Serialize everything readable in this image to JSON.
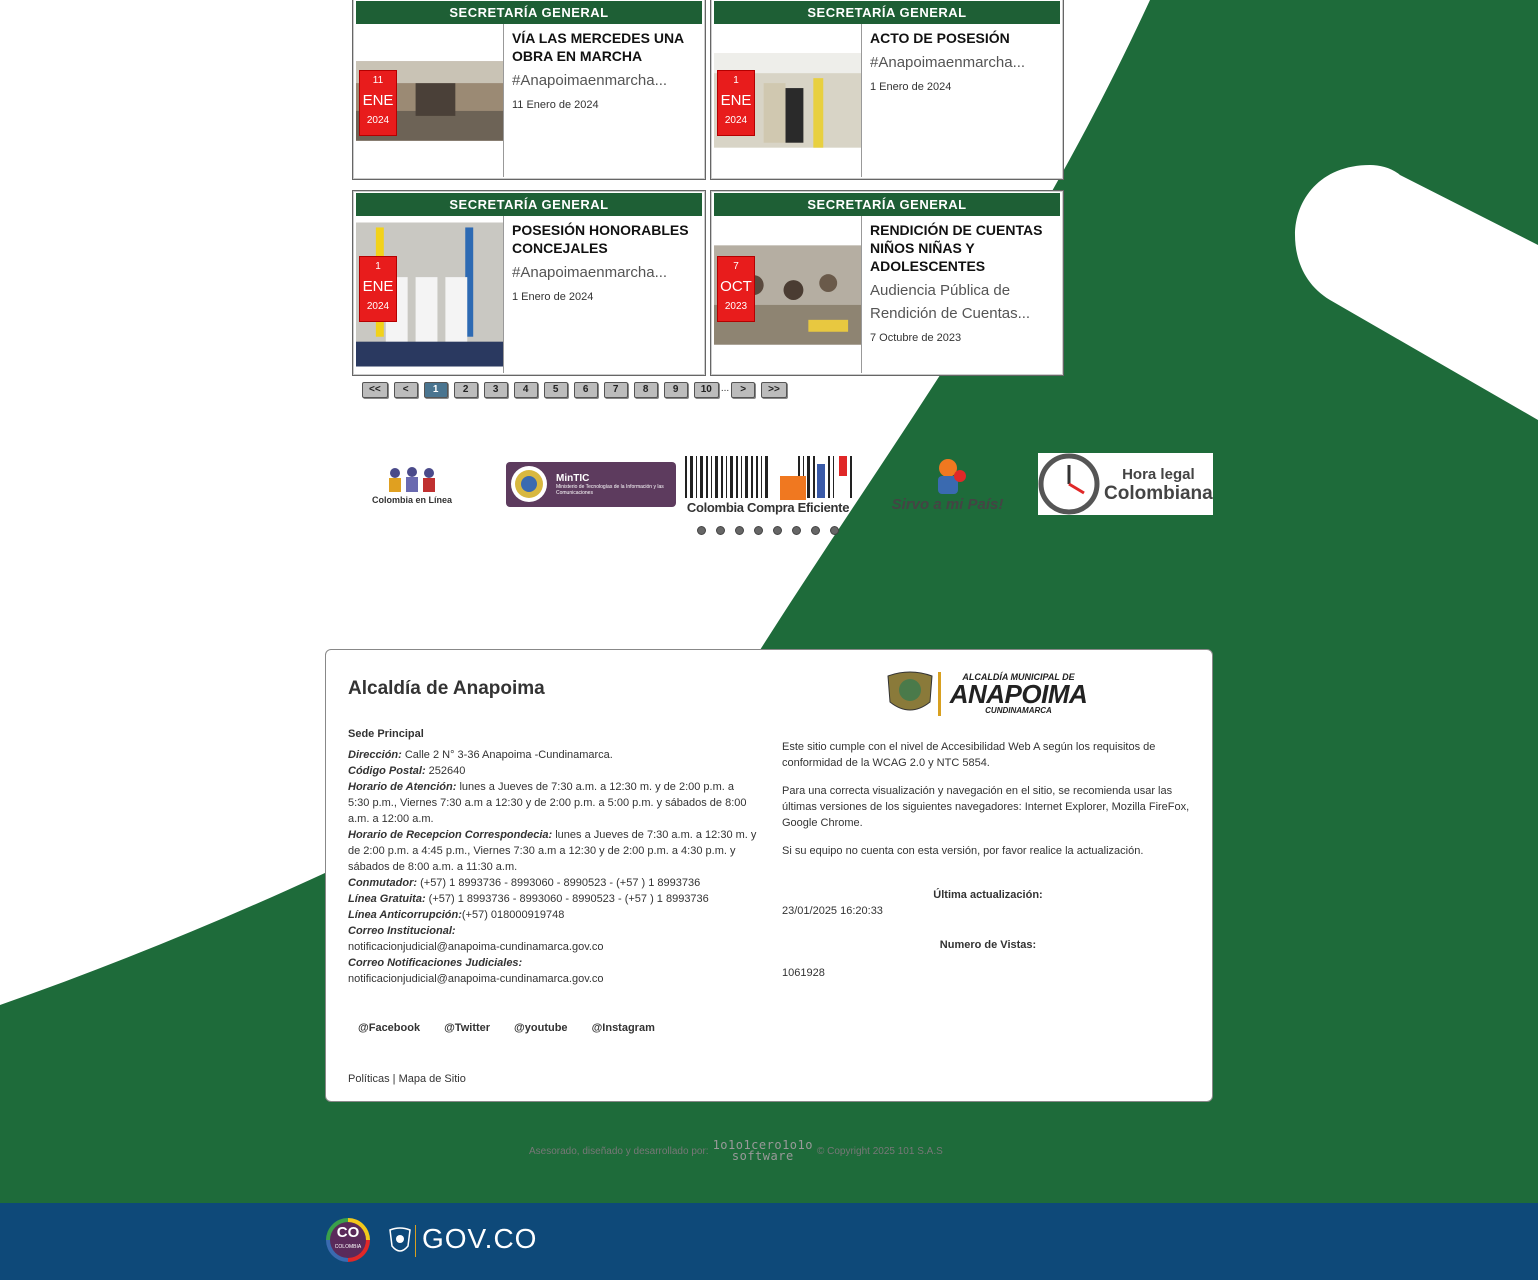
{
  "news": [
    {
      "category": "SECRETARÍA GENERAL",
      "title": "VÍA LAS MERCEDES UNA OBRA EN MARCHA",
      "excerpt": "#Anapoimaenmarcha...",
      "date": "11 Enero de 2024",
      "badge": {
        "day": "11",
        "month": "ENE",
        "year": "2024"
      }
    },
    {
      "category": "SECRETARÍA GENERAL",
      "title": "ACTO DE POSESIÓN",
      "excerpt": "#Anapoimaenmarcha...",
      "date": "1 Enero de 2024",
      "badge": {
        "day": "1",
        "month": "ENE",
        "year": "2024"
      }
    },
    {
      "category": "SECRETARÍA GENERAL",
      "title": "POSESIÓN HONORABLES CONCEJALES",
      "excerpt": "#Anapoimaenmarcha...",
      "date": "1 Enero de 2024",
      "badge": {
        "day": "1",
        "month": "ENE",
        "year": "2024"
      }
    },
    {
      "category": "SECRETARÍA GENERAL",
      "title": "RENDICIÓN DE CUENTAS NIÑOS NIÑAS Y ADOLESCENTES",
      "excerpt": "Audiencia Pública de Rendición de Cuentas...",
      "date": "7 Octubre de 2023",
      "badge": {
        "day": "7",
        "month": "OCT",
        "year": "2023"
      }
    }
  ],
  "pagination": {
    "first": "<<",
    "prev": "<",
    "pages": [
      "1",
      "2",
      "3",
      "4",
      "5",
      "6",
      "7",
      "8",
      "9",
      "10"
    ],
    "ellipsis": "...",
    "next": ">",
    "last": ">>",
    "current": "1"
  },
  "logos": {
    "colombia_en_linea": "Colombia en Línea",
    "mintic": "MinTIC",
    "mintic_sub": "Ministerio de Tecnologías de la Información y las Comunicaciones",
    "compra": "Colombia Compra Eficiente",
    "sirvo": "Sirvo a mi País!",
    "hora1": "Hora legal",
    "hora2": "Colombiana"
  },
  "carousel_dots": 8,
  "footer": {
    "title": "Alcaldía de Anapoima",
    "sede": "Sede Principal",
    "direccion_label": "Dirección:",
    "direccion": " Calle 2 N° 3-36 Anapoima -Cundinamarca.",
    "postal_label": "Código Postal:",
    "postal": " 252640",
    "horario_label": "Horario de Atención:",
    "horario": " lunes a Jueves de 7:30 a.m. a 12:30 m. y de 2:00 p.m. a 5:30 p.m., Viernes 7:30 a.m a 12:30 y de 2:00 p.m. a 5:00 p.m. y sábados de 8:00 a.m. a 12:00 a.m.",
    "correspondencia_label": "Horario de Recepcion Correspondecia:",
    "correspondencia": " lunes a Jueves de 7:30 a.m. a 12:30 m. y de 2:00 p.m. a 4:45 p.m., Viernes 7:30 a.m a 12:30 y de 2:00 p.m. a 4:30 p.m. y sábados de 8:00 a.m. a 11:30 a.m.",
    "conmutador_label": "Conmutador:",
    "conmutador": " (+57) 1 8993736 - 8993060 - 8990523 - (+57 ) 1 8993736",
    "gratuita_label": "Línea Gratuita:",
    "gratuita": " (+57) 1 8993736 - 8993060 - 8990523 - (+57 ) 1 8993736",
    "anticorrupcion_label": "Línea Anticorrupción:",
    "anticorrupcion": "(+57) 018000919748",
    "correo_label": "Correo Institucional:",
    "correo": "notificacionjudicial@anapoima-cundinamarca.gov.co",
    "notif_label": "Correo Notificaciones Judiciales:",
    "notif": "notificacionjudicial@anapoima-cundinamarca.gov.co",
    "social": [
      "@Facebook",
      "@Twitter",
      "@youtube",
      "@Instagram"
    ],
    "politicas": "Políticas",
    "separator": " | ",
    "mapa": "Mapa de Sitio",
    "logo_line1": "ALCALDÍA MUNICIPAL DE",
    "logo_line2": "ANAPOIMA",
    "logo_line3": "CUNDINAMARCA",
    "accesibilidad": "Este sitio cumple con el nivel de Accesibilidad Web A según los requisitos de conformidad de la WCAG 2.0 y NTC 5854.",
    "navegadores": "Para una correcta visualización y navegación en el sitio, se recomienda usar las últimas versiones de los siguientes navegadores: Internet Explorer, Mozilla FireFox, Google Chrome.",
    "actualizar": "Si su equipo no cuenta con esta versión, por favor realice la actualización.",
    "ultima_label": "Última actualización:",
    "ultima": "23/01/2025 16:20:33",
    "vistas_label": "Numero de Vistas:",
    "vistas": "1061928"
  },
  "credit": {
    "text": "Asesorado, diseñado y desarrollado por:",
    "brand1": "1o1o1cero1o1o",
    "brand2": "software",
    "copyright": "© Copyright 2025 101 S.A.S"
  },
  "gov": {
    "co": "CO",
    "colombia": "COLOMBIA",
    "govco": "GOV.CO"
  },
  "colors": {
    "green": "#1e6b3a",
    "banner": "#1e5f35",
    "badge": "#e81c1c",
    "gov_blue": "#0e4979"
  }
}
